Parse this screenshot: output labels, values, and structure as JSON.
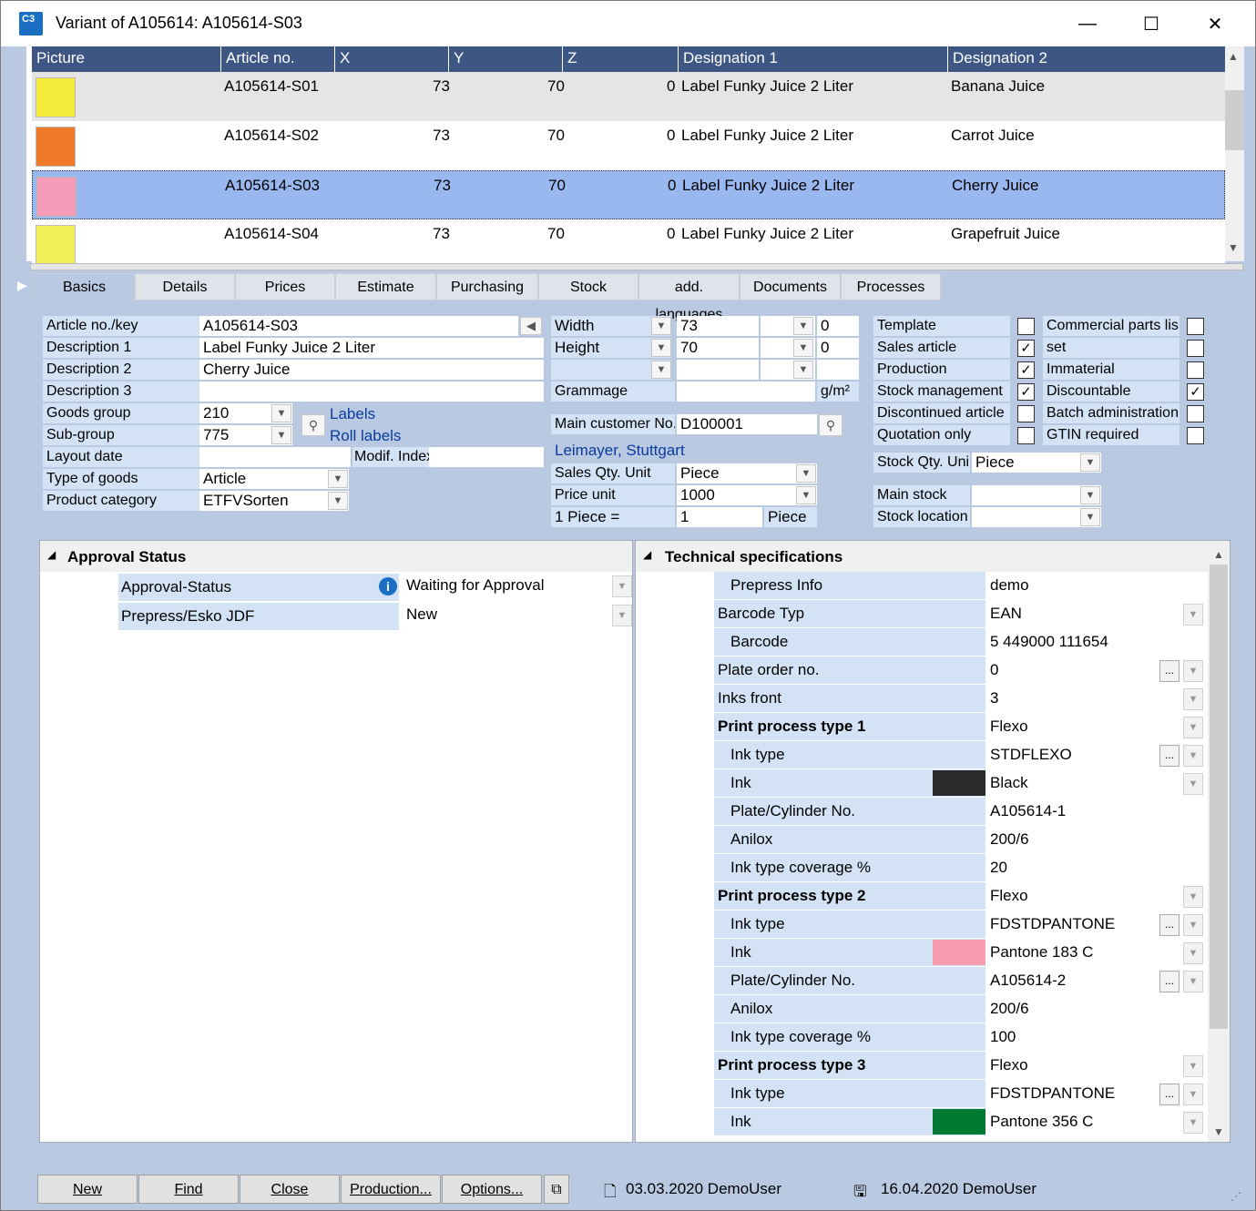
{
  "window": {
    "title": "Variant of A105614: A105614-S03",
    "app_icon": "C3",
    "controls": {
      "minimize": "—",
      "maximize": "☐",
      "close": "✕"
    }
  },
  "grid": {
    "headers": [
      "Picture",
      "Article no.",
      "X",
      "Y",
      "Z",
      "Designation 1",
      "Designation 2"
    ],
    "rows": [
      {
        "article": "A105614-S01",
        "x": "73",
        "y": "70",
        "z": "0",
        "d1": "Label Funky Juice 2 Liter",
        "d2": "Banana Juice",
        "thumb_color": "#f3ea3a"
      },
      {
        "article": "A105614-S02",
        "x": "73",
        "y": "70",
        "z": "0",
        "d1": "Label Funky Juice 2 Liter",
        "d2": "Carrot Juice",
        "thumb_color": "#ee7a2a"
      },
      {
        "article": "A105614-S03",
        "x": "73",
        "y": "70",
        "z": "0",
        "d1": "Label Funky Juice 2 Liter",
        "d2": "Cherry Juice",
        "thumb_color": "#f39bb8"
      },
      {
        "article": "A105614-S04",
        "x": "73",
        "y": "70",
        "z": "0",
        "d1": "Label Funky Juice 2 Liter",
        "d2": "Grapefruit Juice",
        "thumb_color": "#f2f05a"
      }
    ]
  },
  "tabs": [
    "Basics",
    "Details",
    "Prices",
    "Estimate",
    "Purchasing",
    "Stock",
    "add. languages",
    "Documents",
    "Processes"
  ],
  "basics": {
    "article_no_label": "Article no./key",
    "article_no": "A105614-S03",
    "desc1_label": "Description 1",
    "desc1": "Label Funky Juice 2 Liter",
    "desc2_label": "Description 2",
    "desc2": "Cherry Juice",
    "desc3_label": "Description 3",
    "desc3": "",
    "goods_group_label": "Goods group",
    "goods_group": "210",
    "goods_group_link": "Labels",
    "sub_group_label": "Sub-group",
    "sub_group": "775",
    "sub_group_link": "Roll labels",
    "layout_date_label": "Layout date",
    "layout_date": "",
    "modif_index_label": "Modif. Index",
    "modif_index": "",
    "type_goods_label": "Type of goods",
    "type_goods": "Article",
    "product_cat_label": "Product category",
    "product_cat": "ETFVSorten",
    "width_label": "Width",
    "width": "73",
    "width2": "0",
    "height_label": "Height",
    "height": "70",
    "height2": "0",
    "grammage_label": "Grammage",
    "grammage_unit": "g/m²",
    "main_customer_label": "Main customer No.",
    "main_customer": "D100001",
    "customer_name": "Leimayer, Stuttgart",
    "sales_qty_unit_label": "Sales Qty. Unit",
    "sales_qty_unit": "Piece",
    "price_unit_label": "Price unit",
    "price_unit": "1000",
    "conv_label": "1 Piece =",
    "conv_value": "1",
    "conv_unit": "Piece",
    "stock_qty_unit_label": "Stock Qty. Uni",
    "stock_qty_unit": "Piece",
    "main_stock_label": "Main stock",
    "stock_location_label": "Stock location",
    "flags_left": [
      {
        "label": "Template",
        "checked": false
      },
      {
        "label": "Sales article",
        "checked": true
      },
      {
        "label": "Production",
        "checked": true
      },
      {
        "label": "Stock management",
        "checked": true
      },
      {
        "label": "Discontinued article",
        "checked": false
      },
      {
        "label": "Quotation only",
        "checked": false
      }
    ],
    "flags_right": [
      {
        "label": "Commercial parts lis",
        "checked": false
      },
      {
        "label": "set",
        "checked": false
      },
      {
        "label": "Immaterial",
        "checked": false
      },
      {
        "label": "Discountable",
        "checked": true
      },
      {
        "label": "Batch administration",
        "checked": false
      },
      {
        "label": "GTIN required",
        "checked": false
      }
    ]
  },
  "approval": {
    "title": "Approval Status",
    "rows": [
      {
        "label": "Approval-Status",
        "value": "Waiting for Approval"
      },
      {
        "label": "Prepress/Esko JDF",
        "value": "New"
      }
    ]
  },
  "tech": {
    "title": "Technical specifications",
    "rows": [
      {
        "label": "Prepress Info",
        "value": "demo",
        "indent": true,
        "bold": false,
        "dd": false,
        "dots": false,
        "swatch": ""
      },
      {
        "label": "Barcode Typ",
        "value": "EAN",
        "indent": false,
        "bold": false,
        "dd": true,
        "dots": false,
        "swatch": ""
      },
      {
        "label": "Barcode",
        "value": "5 449000 111654",
        "indent": true,
        "bold": false,
        "dd": false,
        "dots": false,
        "swatch": ""
      },
      {
        "label": "Plate order no.",
        "value": "0",
        "indent": false,
        "bold": false,
        "dd": true,
        "dots": true,
        "swatch": ""
      },
      {
        "label": "Inks front",
        "value": "3",
        "indent": false,
        "bold": false,
        "dd": true,
        "dots": false,
        "swatch": ""
      },
      {
        "label": "Print process type 1",
        "value": "Flexo",
        "indent": false,
        "bold": true,
        "dd": true,
        "dots": false,
        "swatch": ""
      },
      {
        "label": "Ink type",
        "value": "STDFLEXO",
        "indent": true,
        "bold": false,
        "dd": true,
        "dots": true,
        "swatch": ""
      },
      {
        "label": "Ink",
        "value": "Black",
        "indent": true,
        "bold": false,
        "dd": true,
        "dots": false,
        "swatch": "#2a2a2a"
      },
      {
        "label": "Plate/Cylinder No.",
        "value": "A105614-1",
        "indent": true,
        "bold": false,
        "dd": false,
        "dots": false,
        "swatch": ""
      },
      {
        "label": "Anilox",
        "value": "200/6",
        "indent": true,
        "bold": false,
        "dd": false,
        "dots": false,
        "swatch": ""
      },
      {
        "label": "Ink type coverage %",
        "value": "20",
        "indent": true,
        "bold": false,
        "dd": false,
        "dots": false,
        "swatch": ""
      },
      {
        "label": "Print process type 2",
        "value": "Flexo",
        "indent": false,
        "bold": true,
        "dd": true,
        "dots": false,
        "swatch": ""
      },
      {
        "label": "Ink type",
        "value": "FDSTDPANTONE",
        "indent": true,
        "bold": false,
        "dd": true,
        "dots": true,
        "swatch": ""
      },
      {
        "label": "Ink",
        "value": "Pantone 183 C",
        "indent": true,
        "bold": false,
        "dd": true,
        "dots": false,
        "swatch": "#f89db0"
      },
      {
        "label": "Plate/Cylinder No.",
        "value": "A105614-2",
        "indent": true,
        "bold": false,
        "dd": true,
        "dots": true,
        "swatch": ""
      },
      {
        "label": "Anilox",
        "value": "200/6",
        "indent": true,
        "bold": false,
        "dd": false,
        "dots": false,
        "swatch": ""
      },
      {
        "label": "Ink type coverage %",
        "value": "100",
        "indent": true,
        "bold": false,
        "dd": false,
        "dots": false,
        "swatch": ""
      },
      {
        "label": "Print process type 3",
        "value": "Flexo",
        "indent": false,
        "bold": true,
        "dd": true,
        "dots": false,
        "swatch": ""
      },
      {
        "label": "Ink type",
        "value": "FDSTDPANTONE",
        "indent": true,
        "bold": false,
        "dd": true,
        "dots": true,
        "swatch": ""
      },
      {
        "label": "Ink",
        "value": "Pantone 356 C",
        "indent": true,
        "bold": false,
        "dd": true,
        "dots": false,
        "swatch": "#007a33"
      }
    ]
  },
  "footer": {
    "buttons": [
      "New",
      "Find",
      "Close",
      "Production...",
      "Options..."
    ],
    "created": "03.03.2020 DemoUser",
    "modified": "16.04.2020 DemoUser"
  }
}
